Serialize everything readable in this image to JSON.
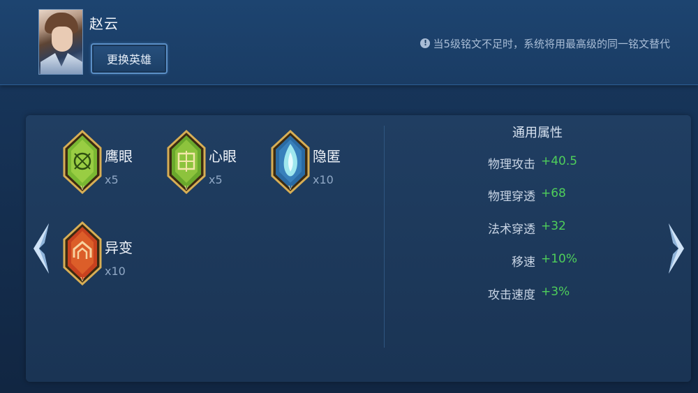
{
  "header": {
    "hero_name": "赵云",
    "change_hero_label": "更换英雄",
    "notice_icon": "!",
    "notice_text": "当5级铭文不足时，系统将用最高级的同一铭文替代"
  },
  "runes": [
    {
      "name": "鹰眼",
      "count": "x5",
      "color": "#6fae2f"
    },
    {
      "name": "心眼",
      "count": "x5",
      "color": "#5f9d2a"
    },
    {
      "name": "隐匿",
      "count": "x10",
      "color": "#2f6fa8"
    },
    {
      "name": "异变",
      "count": "x10",
      "color": "#c8421f"
    }
  ],
  "attributes": {
    "title": "通用属性",
    "rows": [
      {
        "label": "物理攻击",
        "value": "+40.5"
      },
      {
        "label": "物理穿透",
        "value": "+68"
      },
      {
        "label": "法术穿透",
        "value": "+32"
      },
      {
        "label": "移速",
        "value": "+10%"
      },
      {
        "label": "攻击速度",
        "value": "+3%"
      }
    ]
  },
  "colors": {
    "value_green": "#4fcf5a",
    "gold_frame": "#c9a04a"
  }
}
